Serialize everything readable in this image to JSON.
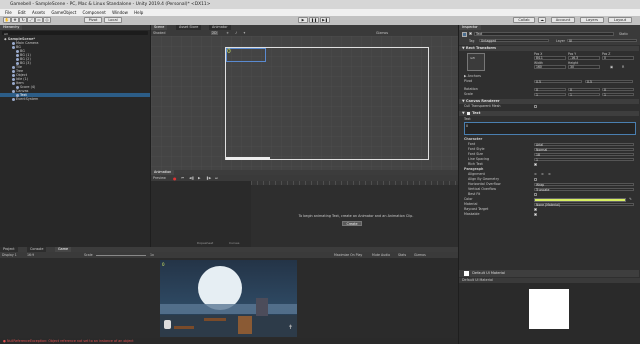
{
  "window": {
    "title": "Gamebell - SampleScene - PC, Mac & Linux Standalone - Unity 2019.4 (Personal)* <DX11>"
  },
  "menu": [
    "File",
    "Edit",
    "Assets",
    "GameObject",
    "Component",
    "Window",
    "Help"
  ],
  "toolbar": {
    "pivot": "Pivot",
    "local": "Local",
    "collab": "Collab",
    "account": "Account",
    "layers": "Layers",
    "layout": "Layout"
  },
  "hierarchy": {
    "tab": "Hierarchy",
    "search_placeholder": "All",
    "scene": "SampleScene*",
    "items": [
      {
        "label": "Main Camera",
        "indent": 2
      },
      {
        "label": "BG",
        "indent": 2
      },
      {
        "label": "BG",
        "indent": 3
      },
      {
        "label": "BG (1)",
        "indent": 3
      },
      {
        "label": "BG (2)",
        "indent": 3
      },
      {
        "label": "BG (3)",
        "indent": 3
      },
      {
        "label": "Tile",
        "indent": 2
      },
      {
        "label": "Tree",
        "indent": 2
      },
      {
        "label": "Object",
        "indent": 2
      },
      {
        "label": "Idle (1)",
        "indent": 2
      },
      {
        "label": "Item",
        "indent": 2
      },
      {
        "label": "Score (4)",
        "indent": 3
      },
      {
        "label": "Canvas",
        "indent": 2
      },
      {
        "label": "Text",
        "indent": 3,
        "selected": true
      },
      {
        "label": "EventSystem",
        "indent": 2
      }
    ]
  },
  "scene_view": {
    "tabs": [
      "Scene",
      "Asset Store",
      "Animator"
    ],
    "shading": "Shaded",
    "mode": "2D",
    "gizmos": "Gizmos"
  },
  "animation": {
    "tab": "Animation",
    "preview": "Preview",
    "message": "To begin animating Text, create an Animator and an Animation Clip.",
    "create_button": "Create",
    "dopesheet": "Dopesheet",
    "curves": "Curves"
  },
  "bottom": {
    "tabs": [
      "Project",
      "Console",
      "Game"
    ],
    "display": "Display 1",
    "aspect": "16:9",
    "scale_label": "Scale",
    "scale_value": "1x",
    "options": [
      "Maximize On Play",
      "Mute Audio",
      "Stats",
      "Gizmos"
    ]
  },
  "status": {
    "error": "NullReferenceException: Object reference not set to an instance of an object"
  },
  "inspector": {
    "tab": "Inspector",
    "object_name": "Text",
    "static": "Static",
    "tag_label": "Tag",
    "tag": "Untagged",
    "layer_label": "Layer",
    "layer": "UI",
    "rect_transform": "Rect Transform",
    "anchor": "left",
    "pos_x_label": "Pos X",
    "pos_x": "84.1",
    "pos_y_label": "Pos Y",
    "pos_y": "-16.3",
    "pos_z_label": "Pos Z",
    "pos_z": "0",
    "width_label": "Width",
    "width": "160",
    "height_label": "Height",
    "height": "30",
    "anchors": "Anchors",
    "pivot_label": "Pivot",
    "pivot_x": "0.5",
    "pivot_y": "0.5",
    "rotation_label": "Rotation",
    "rot_x": "0",
    "rot_y": "0",
    "rot_z": "0",
    "scale_label": "Scale",
    "scale_x": "1",
    "scale_y": "1",
    "scale_z": "1",
    "canvas_renderer": "Canvas Renderer",
    "cull_label": "Cull Transparent Mesh",
    "text_component": "Text",
    "text_label": "Text",
    "text_value": "0",
    "character": "Character",
    "font_label": "Font",
    "font": "Arial",
    "font_style_label": "Font Style",
    "font_style": "Normal",
    "font_size_label": "Font Size",
    "font_size": "18",
    "line_spacing_label": "Line Spacing",
    "line_spacing": "1",
    "rich_text_label": "Rich Text",
    "paragraph": "Paragraph",
    "alignment_label": "Alignment",
    "align_geom_label": "Align By Geometry",
    "h_overflow_label": "Horizontal Overflow",
    "h_overflow": "Wrap",
    "v_overflow_label": "Vertical Overflow",
    "v_overflow": "Truncate",
    "best_fit_label": "Best Fit",
    "color_label": "Color",
    "color": "#d8ef62",
    "material_label": "Material",
    "material": "None (Material)",
    "raycast_label": "Raycast Target",
    "maskable_label": "Maskable",
    "default_material": "Default UI Material",
    "preview_title": "Default UI Material"
  }
}
